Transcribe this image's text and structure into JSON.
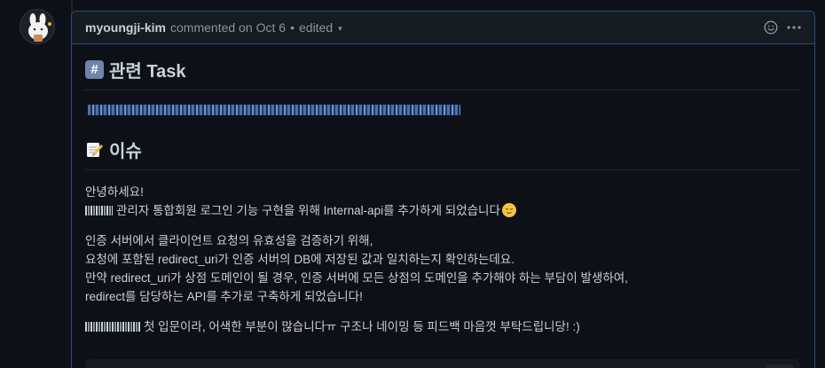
{
  "comment": {
    "author": "myoungji-kim",
    "action": "commented on",
    "date": "Oct 6",
    "separator": "•",
    "edited": "edited",
    "caret": "▾",
    "more": "…"
  },
  "sections": [
    {
      "emoji": "#",
      "title": "관련 Task"
    },
    {
      "title": "이슈"
    }
  ],
  "body": {
    "greeting": "안녕하세요!",
    "line1": "관리자 통합회원 로그인 기능 구현을 위해 Internal-api를 추가하게 되었습니다",
    "p2_line1": "인증 서버에서 클라이언트 요청의 유효성을 검증하기 위해,",
    "p2_line2": "요청에 포함된 redirect_uri가 인증 서버의 DB에 저장된 값과 일치하는지 확인하는데요.",
    "p2_line3": "만약 redirect_uri가 상점 도메인이 될 경우, 인증 서버에 모든 상점의 도메인을 추가해야 하는 부담이 발생하여,",
    "p2_line4": "redirect를 담당하는 API를 추가로 구축하게 되었습니다!",
    "p3": "첫 입문이라, 어색한 부분이 많습니다ㅠ 구조나 네이밍 등 피드백 마음껏 부탁드립니당! :)"
  },
  "colors": {
    "background": "#0d1117",
    "header_bg": "#161b22",
    "border_accent": "#2d4a75",
    "text": "#c9d1d9",
    "muted": "#8b949e"
  },
  "icons": [
    "avatar",
    "smiley-icon",
    "kebab-icon",
    "hash-emoji",
    "memo-emoji",
    "relieved-face-emoji"
  ]
}
